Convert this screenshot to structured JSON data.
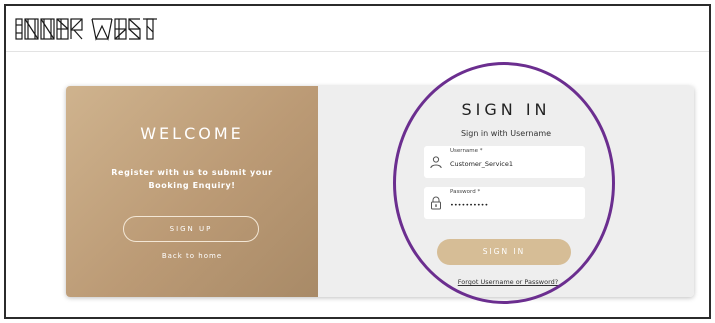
{
  "header": {
    "logo_text": "INNER WEST"
  },
  "left_panel": {
    "title": "WELCOME",
    "text": "Register with us to submit your Booking Enquiry!",
    "signup_label": "SIGN UP",
    "back_home_label": "Back to home"
  },
  "right_panel": {
    "title": "SIGN IN",
    "subtitle": "Sign in with Username",
    "username": {
      "label": "Username *",
      "value": "Customer_Service1",
      "icon": "user-icon"
    },
    "password": {
      "label": "Password *",
      "value": "••••••••••",
      "icon": "lock-icon"
    },
    "signin_label": "SIGN IN",
    "forgot_label": "Forgot Username or Password?"
  },
  "colors": {
    "panel_gold": "#c3a37e",
    "button_gold": "#d6bd96",
    "highlight_purple": "#6b2e8f",
    "right_bg": "#eeeeee"
  }
}
